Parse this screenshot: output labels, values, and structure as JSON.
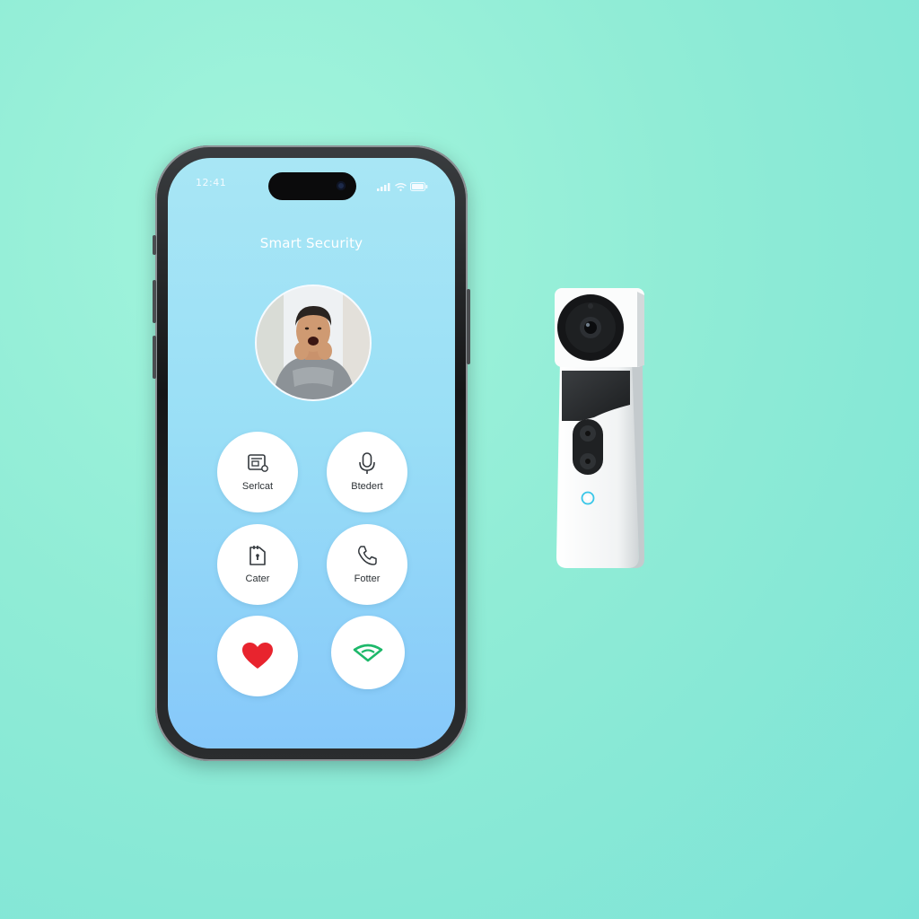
{
  "status_bar": {
    "time": "12:41"
  },
  "app": {
    "title": "Smart Security"
  },
  "actions": [
    {
      "label": "Serlcat",
      "icon": "screen-icon"
    },
    {
      "label": "Btedert",
      "icon": "microphone-icon"
    },
    {
      "label": "Cater",
      "icon": "lock-icon"
    },
    {
      "label": "Fotter",
      "icon": "phone-icon"
    },
    {
      "label": "",
      "icon": "heart-icon"
    },
    {
      "label": "",
      "icon": "wifi-icon"
    }
  ],
  "colors": {
    "background": "#8eead8",
    "screen_top": "#a8e6f5",
    "screen_bottom": "#86c8fa",
    "heart": "#e8242e",
    "wifi": "#1db86a",
    "doorbell_led": "#38c6e8"
  }
}
